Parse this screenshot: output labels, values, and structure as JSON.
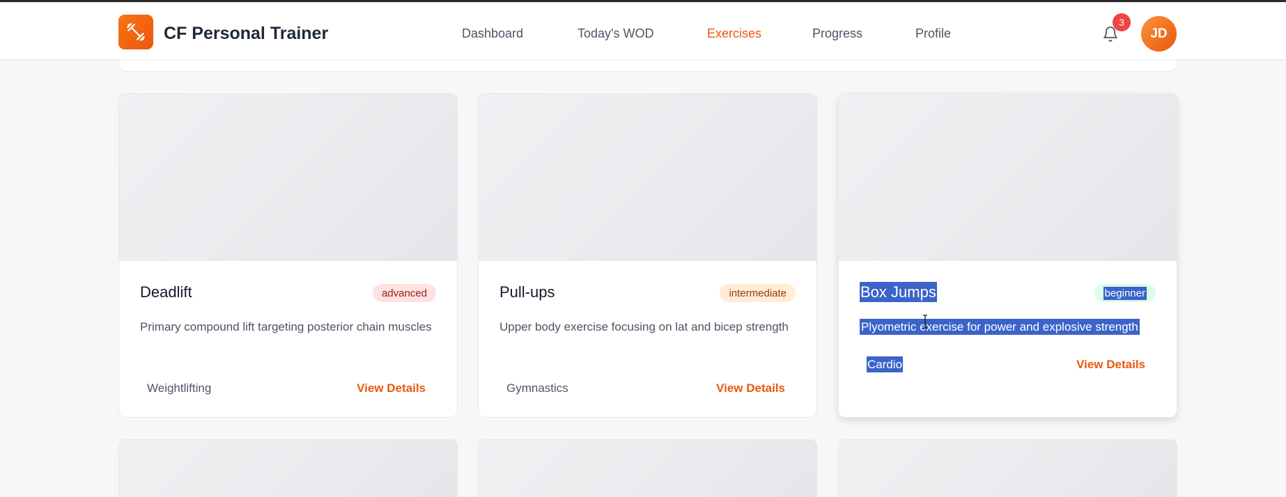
{
  "app": {
    "brand": "CF Personal Trainer",
    "accent": "#ea580c"
  },
  "nav": {
    "items": [
      {
        "label": "Dashboard",
        "active": false
      },
      {
        "label": "Today's WOD",
        "active": false
      },
      {
        "label": "Exercises",
        "active": true
      },
      {
        "label": "Progress",
        "active": false
      },
      {
        "label": "Profile",
        "active": false
      }
    ],
    "notifications_count": "3",
    "avatar_initials": "JD",
    "bell_icon": "bell-icon",
    "logo_icon": "dumbbell-icon"
  },
  "exercises": [
    {
      "name": "Deadlift",
      "level": "advanced",
      "description": "Primary compound lift targeting posterior chain muscles",
      "category": "Weightlifting",
      "link": "View Details"
    },
    {
      "name": "Pull-ups",
      "level": "intermediate",
      "description": "Upper body exercise focusing on lat and bicep strength",
      "category": "Gymnastics",
      "link": "View Details"
    },
    {
      "name": "Box Jumps",
      "level": "beginner",
      "description": "Plyometric exercise for power and explosive strength",
      "category": "Cardio",
      "link": "View Details"
    }
  ]
}
